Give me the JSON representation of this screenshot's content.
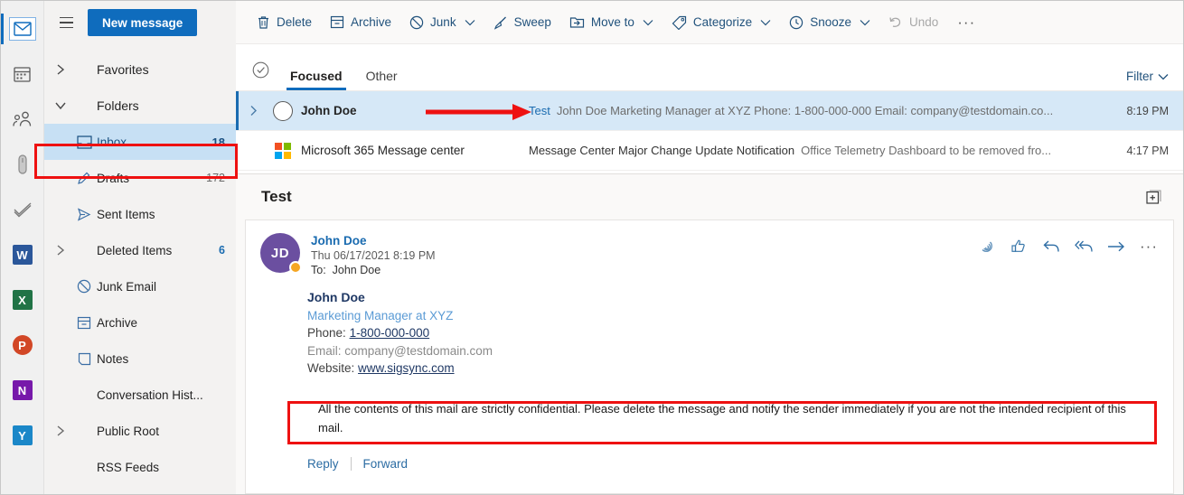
{
  "app_rail": {
    "items": [
      {
        "name": "mail",
        "label": "Mail",
        "icon": "envelope-icon",
        "active": true
      },
      {
        "name": "calendar",
        "label": "Calendar",
        "icon": "calendar-icon",
        "active": false
      },
      {
        "name": "people",
        "label": "People",
        "icon": "people-icon",
        "active": false
      },
      {
        "name": "files",
        "label": "Files",
        "icon": "tag-icon",
        "active": false
      },
      {
        "name": "todo",
        "label": "To Do",
        "icon": "checkmark-icon",
        "active": false
      },
      {
        "name": "word",
        "label": "W",
        "icon": "word-icon",
        "active": false
      },
      {
        "name": "excel",
        "label": "X",
        "icon": "excel-icon",
        "active": false
      },
      {
        "name": "powerpoint",
        "label": "P",
        "icon": "powerpoint-icon",
        "active": false
      },
      {
        "name": "onenote",
        "label": "N",
        "icon": "onenote-icon",
        "active": false
      },
      {
        "name": "yammer",
        "label": "Y",
        "icon": "yammer-icon",
        "active": false
      }
    ]
  },
  "sidebar": {
    "new_message_label": "New message",
    "groups": [
      {
        "label": "Favorites",
        "expanded": false
      },
      {
        "label": "Folders",
        "expanded": true
      }
    ],
    "folders": [
      {
        "label": "Inbox",
        "count": "18",
        "icon": "inbox-icon",
        "selected": true,
        "chevron": false
      },
      {
        "label": "Drafts",
        "count": "172",
        "icon": "pencil-icon",
        "selected": false,
        "chevron": false
      },
      {
        "label": "Sent Items",
        "count": "",
        "icon": "send-icon",
        "selected": false,
        "chevron": false
      },
      {
        "label": "Deleted Items",
        "count": "6",
        "icon": "",
        "selected": false,
        "chevron": true
      },
      {
        "label": "Junk Email",
        "count": "",
        "icon": "block-icon",
        "selected": false,
        "chevron": false
      },
      {
        "label": "Archive",
        "count": "",
        "icon": "archive-icon",
        "selected": false,
        "chevron": false
      },
      {
        "label": "Notes",
        "count": "",
        "icon": "note-icon",
        "selected": false,
        "chevron": false
      },
      {
        "label": "Conversation Hist...",
        "count": "",
        "icon": "",
        "selected": false,
        "chevron": false
      },
      {
        "label": "Public Root",
        "count": "",
        "icon": "",
        "selected": false,
        "chevron": true
      },
      {
        "label": "RSS Feeds",
        "count": "",
        "icon": "",
        "selected": false,
        "chevron": false
      }
    ]
  },
  "toolbar": {
    "items": [
      {
        "label": "Delete",
        "icon": "trash-icon",
        "caret": false,
        "disabled": false
      },
      {
        "label": "Archive",
        "icon": "archive-icon",
        "caret": false,
        "disabled": false
      },
      {
        "label": "Junk",
        "icon": "block-icon",
        "caret": true,
        "disabled": false
      },
      {
        "label": "Sweep",
        "icon": "broom-icon",
        "caret": false,
        "disabled": false
      },
      {
        "label": "Move to",
        "icon": "move-icon",
        "caret": true,
        "disabled": false
      },
      {
        "label": "Categorize",
        "icon": "tag-icon",
        "caret": true,
        "disabled": false
      },
      {
        "label": "Snooze",
        "icon": "clock-icon",
        "caret": true,
        "disabled": false
      },
      {
        "label": "Undo",
        "icon": "undo-icon",
        "caret": false,
        "disabled": true
      }
    ],
    "overflow": "···"
  },
  "list_header": {
    "tabs": [
      {
        "label": "Focused",
        "active": true
      },
      {
        "label": "Other",
        "active": false
      }
    ],
    "filter_label": "Filter"
  },
  "messages": [
    {
      "sender": "John Doe",
      "subject": "Test",
      "preview": "John Doe Marketing Manager at XYZ Phone: 1-800-000-000 Email: company@testdomain.co...",
      "time": "8:19 PM",
      "selected": true,
      "unread": true,
      "avatar_type": "ring"
    },
    {
      "sender": "Microsoft 365 Message center",
      "subject": "Message Center Major Change Update Notification",
      "preview": "Office Telemetry Dashboard to be removed fro...",
      "time": "4:17 PM",
      "selected": false,
      "unread": false,
      "avatar_type": "ms-logo"
    },
    {
      "sender": "",
      "subject": "",
      "preview": "",
      "time": "",
      "selected": false,
      "unread": false,
      "avatar_type": "dark"
    }
  ],
  "reading_pane": {
    "subject": "Test",
    "sender_initials": "JD",
    "sender_name": "John Doe",
    "date": "Thu 06/17/2021 8:19 PM",
    "to_label": "To:",
    "to_value": "John Doe",
    "actions": [
      {
        "name": "react-icon",
        "glyph": "react"
      },
      {
        "name": "thumbs-up-icon",
        "glyph": "like"
      },
      {
        "name": "reply-icon",
        "glyph": "reply"
      },
      {
        "name": "reply-all-icon",
        "glyph": "reply-all"
      },
      {
        "name": "forward-icon",
        "glyph": "forward"
      },
      {
        "name": "more-actions-icon",
        "glyph": "more"
      }
    ],
    "signature": {
      "name": "John Doe",
      "title": "Marketing Manager at XYZ",
      "phone_label": "Phone:",
      "phone_value": "1-800-000-000",
      "email_label": "Email:",
      "email_value": "company@testdomain.com",
      "website_label": "Website:",
      "website_value": "www.sigsync.com"
    },
    "disclaimer": "All the contents of this mail are strictly confidential. Please delete the message and notify the sender immediately if you are not the intended recipient of this mail.",
    "reply_label": "Reply",
    "forward_label": "Forward"
  },
  "annotations": {
    "highlight_color": "#ee1111",
    "boxes": [
      "inbox-folder",
      "signature-disclaimer"
    ],
    "arrow": "points-to-subject-preview"
  },
  "colors": {
    "accent": "#0f6cbd",
    "selected_row": "#d6e8f7",
    "selected_folder": "#c7e0f4",
    "annotation": "#ee1111",
    "avatar": "#6b4fa0",
    "presence": "#f5a623"
  }
}
